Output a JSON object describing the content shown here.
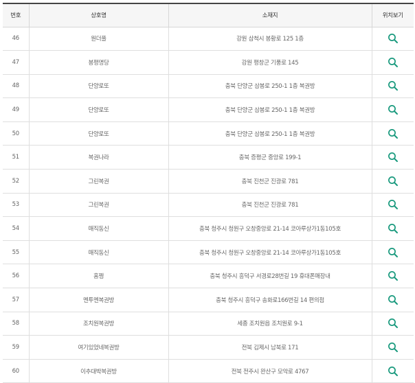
{
  "table": {
    "headers": {
      "number": "번호",
      "store": "상호명",
      "address": "소재지",
      "map": "위치보기"
    },
    "accent_color": "#1a9a7e",
    "row_action_icon": "search-icon",
    "rows": [
      {
        "number": "46",
        "store": "원더풀",
        "address": "강원 삼척시 봉황로 125 1층"
      },
      {
        "number": "47",
        "store": "봉평명당",
        "address": "강원 평창군 기풍로 145"
      },
      {
        "number": "48",
        "store": "단양로또",
        "address": "충북 단양군 삼봉로 250-1 1층 복권방"
      },
      {
        "number": "49",
        "store": "단양로또",
        "address": "충북 단양군 삼봉로 250-1 1층 복권방"
      },
      {
        "number": "50",
        "store": "단양로또",
        "address": "충북 단양군 삼봉로 250-1 1층 복권방"
      },
      {
        "number": "51",
        "store": "복권나라",
        "address": "충북 증평군 중앙로 199-1"
      },
      {
        "number": "52",
        "store": "그린복권",
        "address": "충북 진천군 진광로 781"
      },
      {
        "number": "53",
        "store": "그린복권",
        "address": "충북 진천군 진광로 781"
      },
      {
        "number": "54",
        "store": "매직동신",
        "address": "충북 청주시 청원구 오창중앙로 21-14 코아루상가1동105호"
      },
      {
        "number": "55",
        "store": "매직동신",
        "address": "충북 청주시 청원구 오창중앙로 21-14 코아루상가1동105호"
      },
      {
        "number": "56",
        "store": "홈쩡",
        "address": "충북 청주시 흥덕구 서경로28번길 19 휴대폰매장내"
      },
      {
        "number": "57",
        "store": "멘투멘복권방",
        "address": "충북 청주시 흥덕구 송화로166번길 14 편의점"
      },
      {
        "number": "58",
        "store": "조치원복권방",
        "address": "세종 조치원읍 조치원로 9-1"
      },
      {
        "number": "59",
        "store": "여기있었네복권방",
        "address": "전북 김제시 남북로 171"
      },
      {
        "number": "60",
        "store": "이추대박복권방",
        "address": "전북 전주시 완산구 모악로 4767"
      }
    ]
  }
}
